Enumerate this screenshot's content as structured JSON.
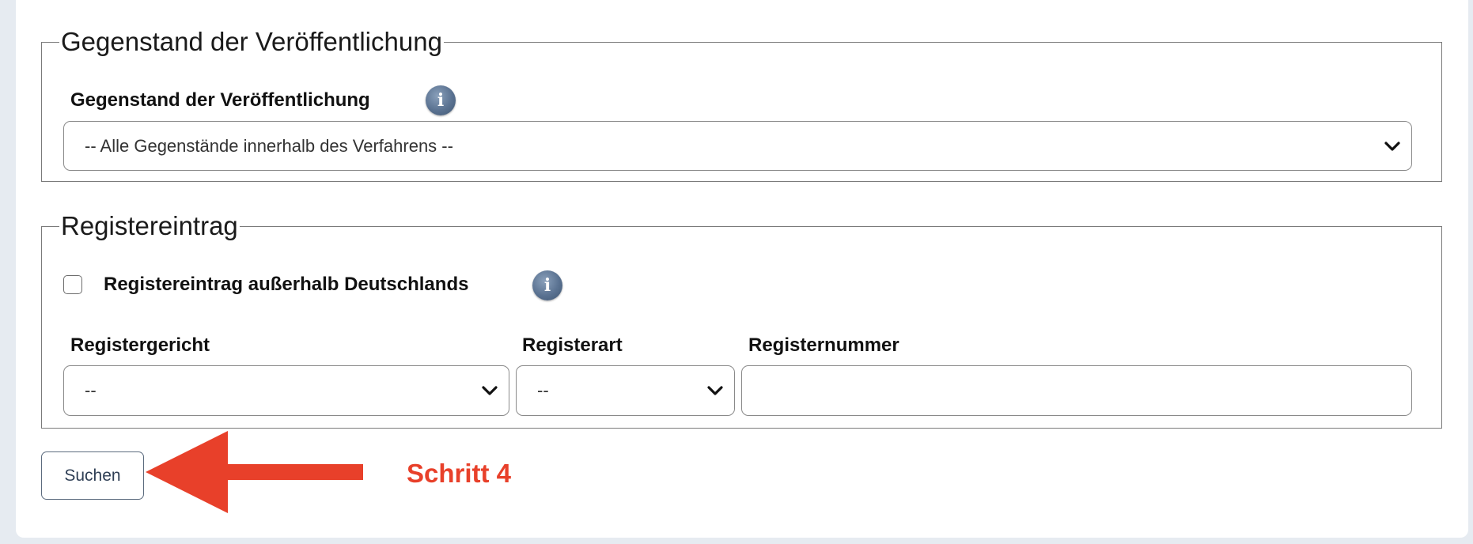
{
  "sections": {
    "subject": {
      "legend": "Gegenstand der Veröffentlichung",
      "field_label": "Gegenstand der Veröffentlichung",
      "select_value": "-- Alle Gegenstände innerhalb des Verfahrens --"
    },
    "register": {
      "legend": "Registereintrag",
      "checkbox_label": "Registereintrag außerhalb Deutschlands",
      "checkbox_checked": false,
      "court_label": "Registergericht",
      "court_value": "--",
      "type_label": "Registerart",
      "type_value": "--",
      "number_label": "Registernummer",
      "number_value": ""
    }
  },
  "actions": {
    "search_label": "Suchen"
  },
  "annotation": {
    "text": "Schritt 4",
    "color": "#e8402a"
  },
  "icons": {
    "info": "info-icon",
    "chevron": "chevron-down-icon",
    "arrow": "arrow-left-icon"
  }
}
